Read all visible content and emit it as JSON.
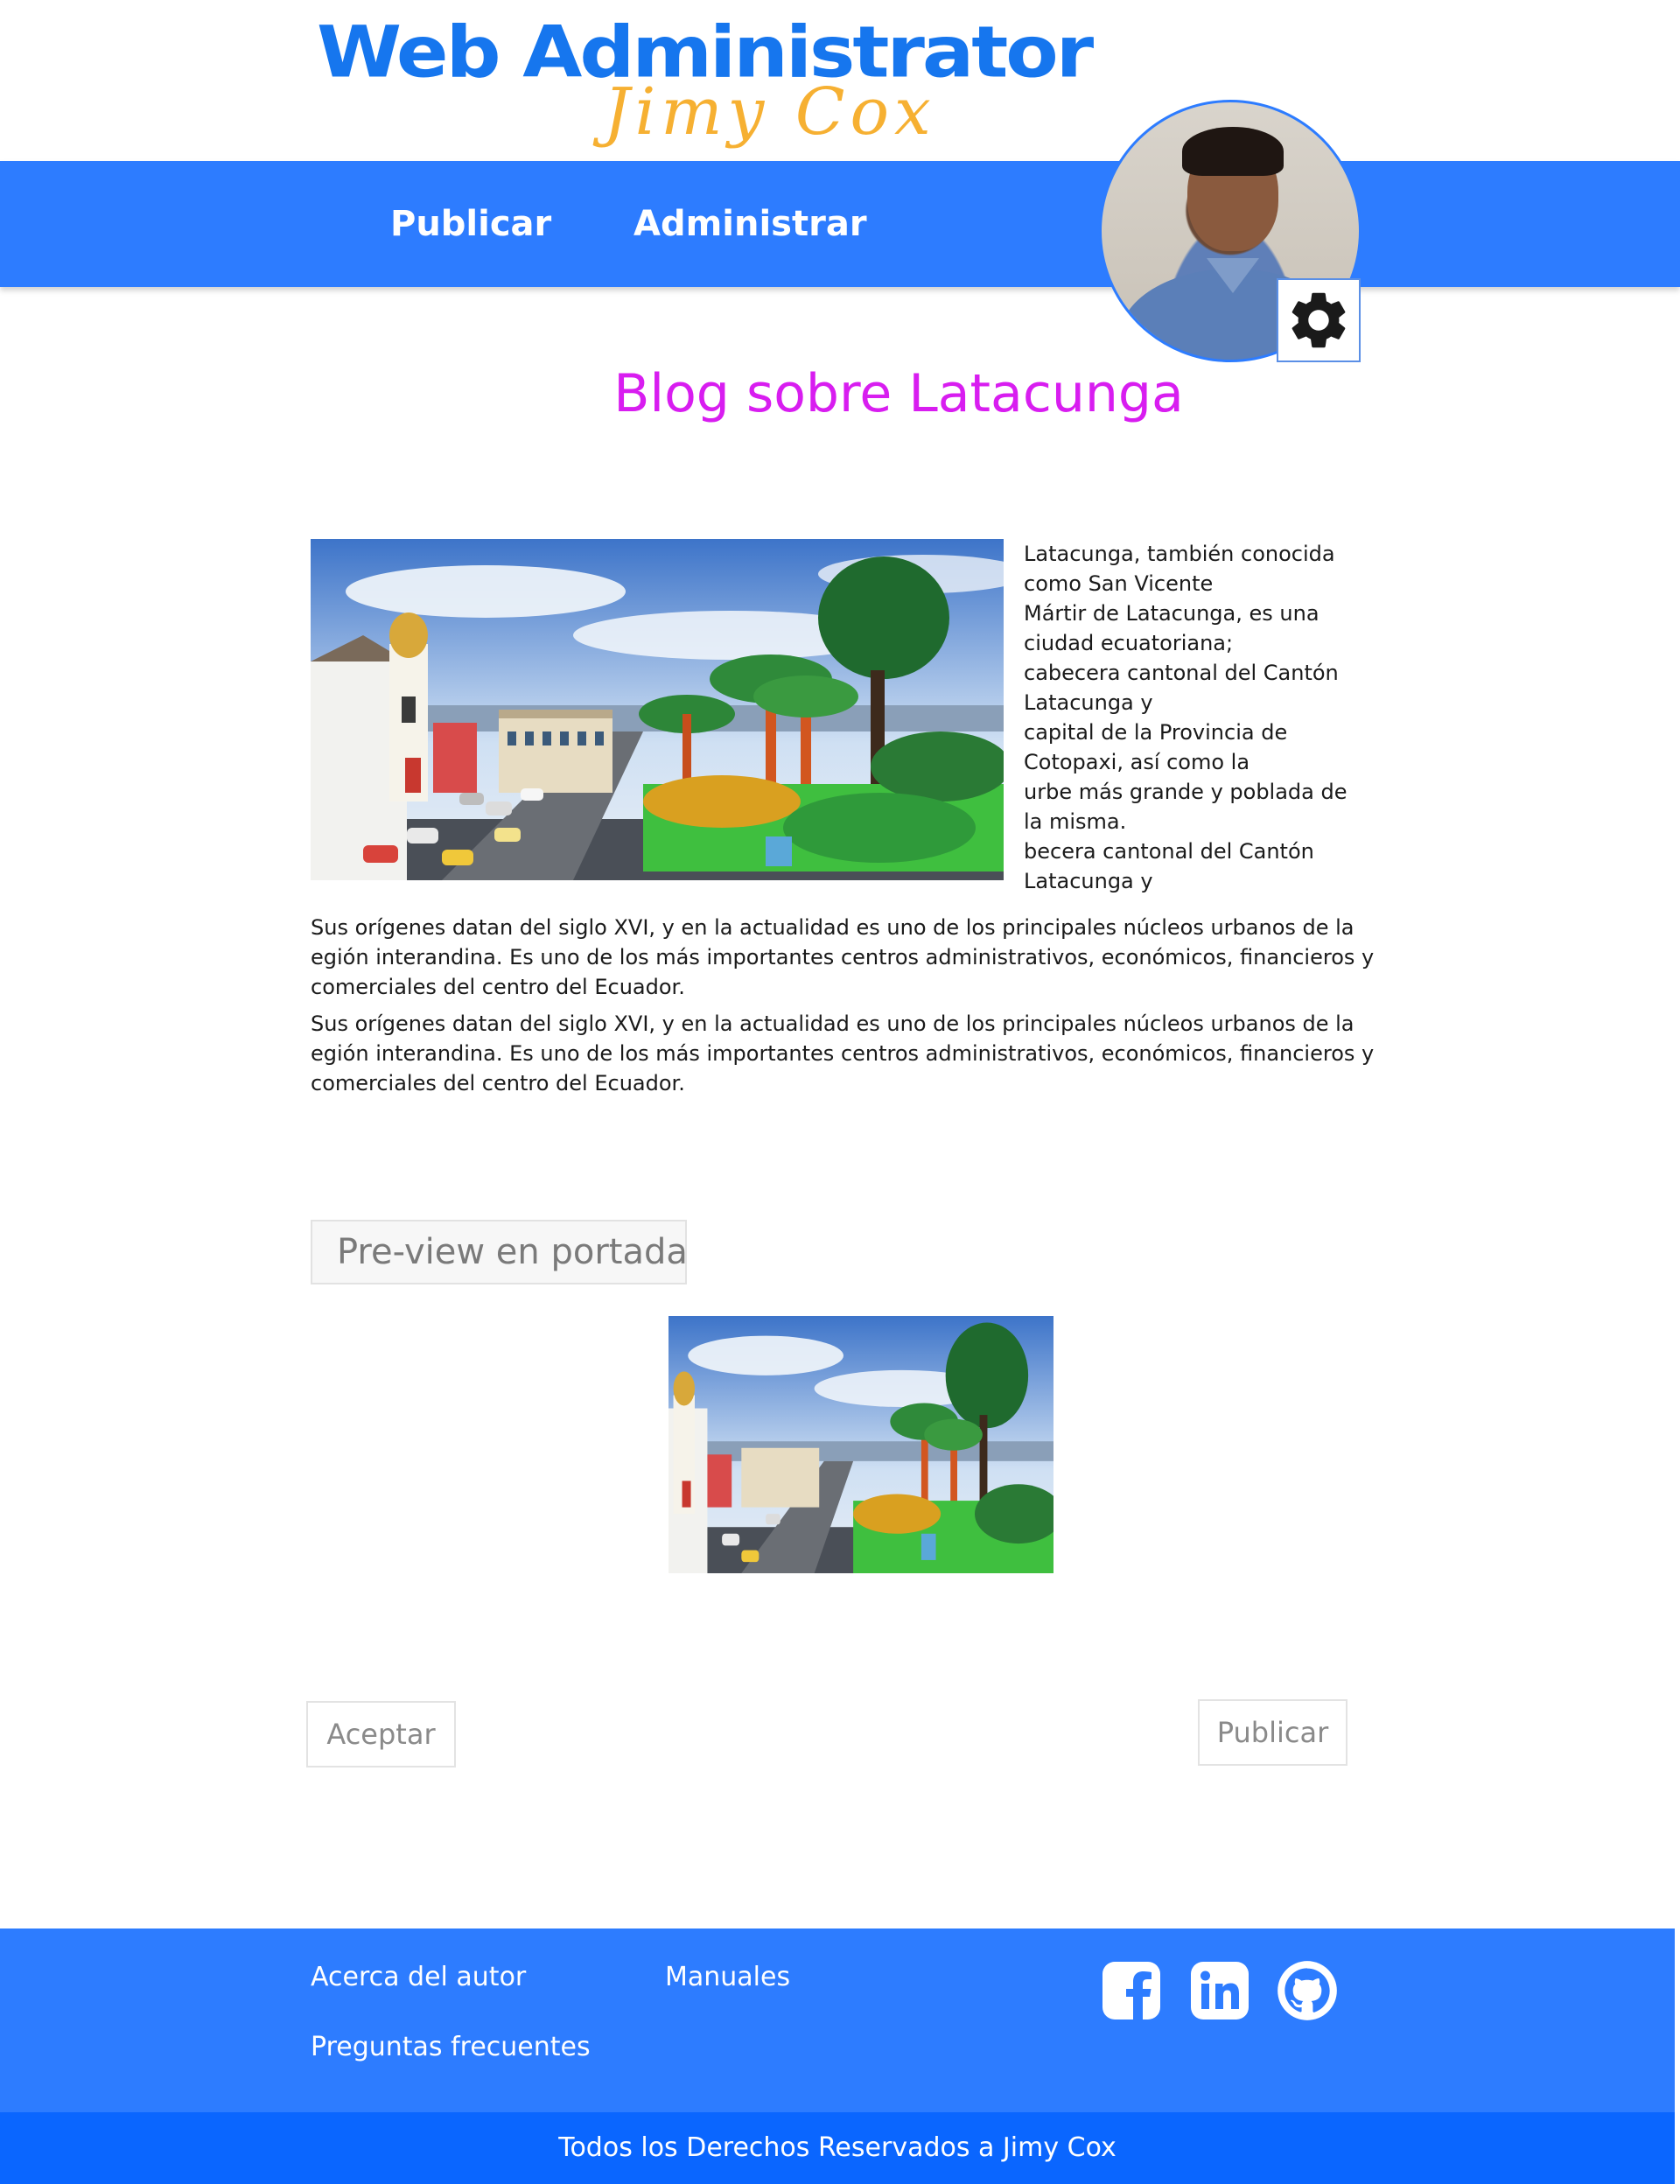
{
  "header": {
    "logo_title": "Web Administrator",
    "logo_subtitle": "Jimy Cox",
    "nav": [
      {
        "label": "Publicar"
      },
      {
        "label": "Administrar"
      }
    ],
    "avatar_icon": "user-avatar",
    "settings_icon": "gear-icon"
  },
  "colors": {
    "brand_blue": "#2d7cff",
    "footer_bottom": "#0a66ff",
    "title_magenta": "#d81df0",
    "logo_blue": "#1676ee",
    "logo_orange": "#f6b032"
  },
  "main": {
    "title": "Blog sobre Latacunga",
    "side_text_lines": [
      "Latacunga, también conocida",
      "como San Vicente",
      "Mártir de Latacunga, es una",
      "ciudad ecuatoriana;",
      "cabecera cantonal del Cantón",
      "Latacunga y",
      "capital de la Provincia de",
      "Cotopaxi, así como la",
      "urbe más grande y poblada de",
      "la misma.",
      "becera cantonal del Cantón",
      "Latacunga y"
    ],
    "paragraph_1_lines": [
      "Sus orígenes datan del siglo XVI, y en la  actualidad es uno de los principales núcleos urbanos de la",
      "egión interandina. Es uno de los más importantes centros administrativos, económicos, financieros y",
      "comerciales del  centro del Ecuador."
    ],
    "paragraph_2_lines": [
      "Sus orígenes datan del siglo XVI, y en la  actualidad es uno de los principales núcleos urbanos de la",
      "egión interandina. Es uno de los más importantes centros administrativos, económicos, financieros y",
      "comerciales del  centro del Ecuador."
    ],
    "preview_label": "Pre-view en portada",
    "accept_label": "Aceptar",
    "publish_label": "Publicar"
  },
  "footer": {
    "links": {
      "about": "Acerca del autor",
      "manuals": "Manuales",
      "faq": "Preguntas frecuentes"
    },
    "social_icons": [
      "facebook-icon",
      "linkedin-icon",
      "github-icon"
    ],
    "copyright": "Todos los Derechos Reservados a Jimy Cox"
  }
}
